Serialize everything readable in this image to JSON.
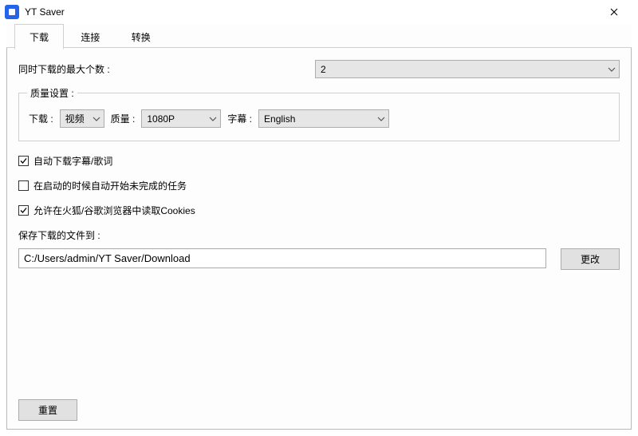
{
  "window": {
    "title": "YT Saver"
  },
  "tabs": {
    "download": "下载",
    "connect": "连接",
    "convert": "转换"
  },
  "max_downloads": {
    "label": "同时下载的最大个数 :",
    "value": "2"
  },
  "quality": {
    "legend": "质量设置 :",
    "download_label": "下载 :",
    "download_value": "视频",
    "quality_label": "质量 :",
    "quality_value": "1080P",
    "subtitle_label": "字幕 :",
    "subtitle_value": "English"
  },
  "checkboxes": {
    "auto_subtitle": "自动下载字幕/歌词",
    "auto_resume": "在启动的时候自动开始未完成的任务",
    "allow_cookies": "允许在火狐/谷歌浏览器中读取Cookies"
  },
  "save": {
    "label": "保存下载的文件到 :",
    "path": "C:/Users/admin/YT Saver/Download",
    "change": "更改"
  },
  "footer": {
    "reset": "重置"
  }
}
